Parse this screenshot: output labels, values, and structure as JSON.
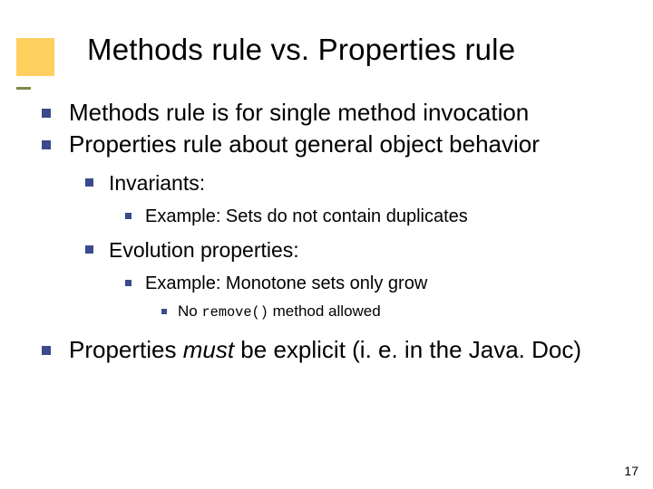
{
  "title": "Methods rule vs. Properties rule",
  "bullets": {
    "b1": "Methods rule is for single method invocation",
    "b2": "Properties rule about general object behavior",
    "b2_1": "Invariants:",
    "b2_1_1": "Example: Sets do not contain duplicates",
    "b2_2": "Evolution properties:",
    "b2_2_1": "Example: Monotone sets only grow",
    "b2_2_1_1_pre": "No ",
    "b2_2_1_1_code": "remove()",
    "b2_2_1_1_post": " method allowed",
    "b3_pre": "Properties ",
    "b3_em": "must",
    "b3_post": " be explicit (i. e. in the Java. Doc)"
  },
  "page_number": "17"
}
